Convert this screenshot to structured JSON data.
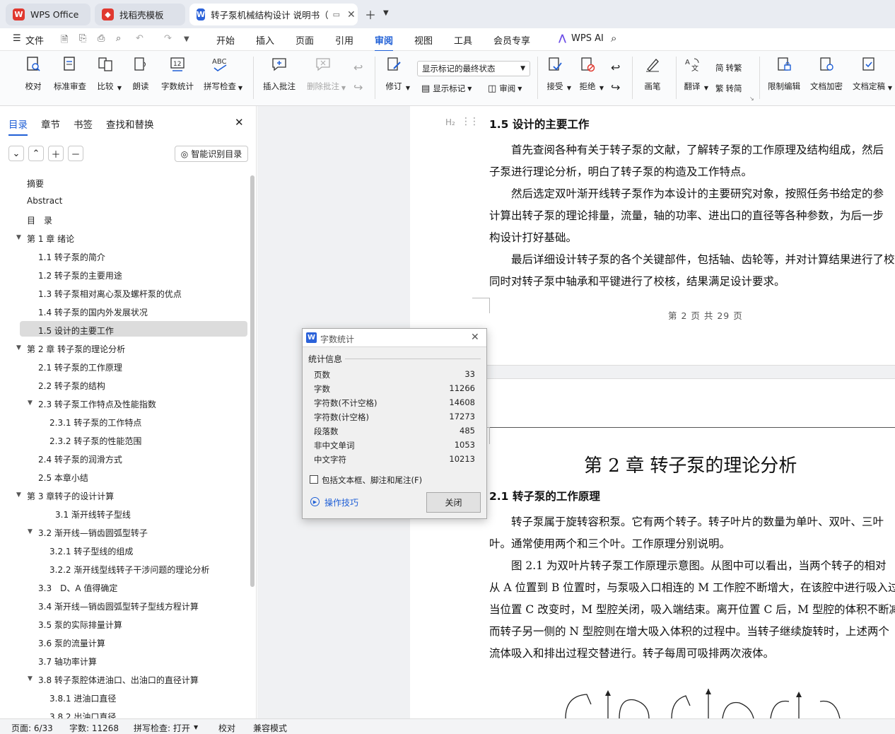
{
  "tabs": [
    {
      "label": "WPS Office"
    },
    {
      "label": "找稻壳模板"
    },
    {
      "label": "转子泵机械结构设计 说明书（"
    }
  ],
  "menu": {
    "file": "文件",
    "items": [
      "开始",
      "插入",
      "页面",
      "引用",
      "审阅",
      "视图",
      "工具",
      "会员专享"
    ],
    "active": "审阅",
    "ai": "WPS AI"
  },
  "ribbon": {
    "jiaodui": "校对",
    "biaozhun": "标准审查",
    "bijiao": "比较",
    "langdu": "朗读",
    "zishu": "字数统计",
    "pinxie": "拼写检查",
    "charu": "插入批注",
    "shanchu": "删除批注",
    "xiuding": "修订",
    "dropdown": "显示标记的最终状态",
    "xianshi": "显示标记",
    "shenyue": "审阅",
    "jieshou": "接受",
    "jujue": "拒绝",
    "huabi": "画笔",
    "fanyi": "翻译",
    "zhuanfan": "转繁",
    "zhuanjian": "转简",
    "xianzhi": "限制编辑",
    "jiami": "文档加密",
    "dinggao": "文档定稿"
  },
  "panel": {
    "tabs": [
      "目录",
      "章节",
      "书签",
      "查找和替换"
    ],
    "smart": "智能识别目录",
    "toc": [
      {
        "text": "摘要",
        "level": 0
      },
      {
        "text": "Abstract",
        "level": 0
      },
      {
        "text": "目　录",
        "level": 0
      },
      {
        "text": "第 1 章  绪论",
        "level": 0,
        "exp": true
      },
      {
        "text": "1.1  转子泵的简介",
        "level": 1
      },
      {
        "text": "1.2  转子泵的主要用途",
        "level": 1
      },
      {
        "text": "1.3  转子泵相对离心泵及螺杆泵的优点",
        "level": 1
      },
      {
        "text": "1.4  转子泵的国内外发展状况",
        "level": 1
      },
      {
        "text": "1.5  设计的主要工作",
        "level": 1,
        "sel": true
      },
      {
        "text": "第 2 章  转子泵的理论分析",
        "level": 0,
        "exp": true
      },
      {
        "text": "2.1  转子泵的工作原理",
        "level": 1
      },
      {
        "text": "2.2  转子泵的结构",
        "level": 1
      },
      {
        "text": "2.3  转子泵工作特点及性能指数",
        "level": 1,
        "exp": true
      },
      {
        "text": "2.3.1  转子泵的工作特点",
        "level": 2
      },
      {
        "text": "2.3.2  转子泵的性能范围",
        "level": 2
      },
      {
        "text": "2.4  转子泵的润滑方式",
        "level": 1
      },
      {
        "text": "2.5  本章小结",
        "level": 1
      },
      {
        "text": "第 3 章转子的设计计算",
        "level": 0,
        "exp": true
      },
      {
        "text": "3.1  渐开线转子型线",
        "level": 3
      },
      {
        "text": "3.2  渐开线—销齿圆弧型转子",
        "level": 1,
        "exp": true
      },
      {
        "text": "3.2.1  转子型线的组成",
        "level": 2
      },
      {
        "text": "3.2.2  渐开线型线转子干涉问题的理论分析",
        "level": 2
      },
      {
        "text": "3.3　D、A 值得确定",
        "level": 1
      },
      {
        "text": "3.4  渐开线—销齿圆弧型转子型线方程计算",
        "level": 1
      },
      {
        "text": "3.5  泵的实际排量计算",
        "level": 1
      },
      {
        "text": "3.6  泵的流量计算",
        "level": 1
      },
      {
        "text": "3.7  轴功率计算",
        "level": 1
      },
      {
        "text": "3.8  转子泵腔体进油口、出油口的直径计算",
        "level": 1,
        "exp": true
      },
      {
        "text": "3.8.1  进油口直径",
        "level": 2
      },
      {
        "text": "3.8.2  出油口直径",
        "level": 2
      }
    ]
  },
  "doc": {
    "h15": "1.5  设计的主要工作",
    "h2mark": "H₂",
    "p": [
      "首先查阅各种有关于转子泵的文献，了解转子泵的工作原理及结构组成，然后",
      "子泵进行理论分析，明白了转子泵的构造及工作特点。",
      "然后选定双叶渐开线转子泵作为本设计的主要研究对象，按照任务书给定的参",
      "计算出转子泵的理论排量，流量，轴的功率、进出口的直径等各种参数，为后一步",
      "构设计打好基础。",
      "最后详细设计转子泵的各个关键部件，包括轴、齿轮等，并对计算结果进行了校",
      "同时对转子泵中轴承和平键进行了校核，结果满足设计要求。"
    ],
    "footer": "第 2 页 共 29 页",
    "chapter": "第 2 章  转子泵的理论分析",
    "h21": "2.1  转子泵的工作原理",
    "q": [
      "转子泵属于旋转容积泵。它有两个转子。转子叶片的数量为单叶、双叶、三叶",
      "叶。通常使用两个和三个叶。工作原理分别说明。",
      "图 2.1 为双叶片转子泵工作原理示意图。从图中可以看出，当两个转子的相对",
      "从 A 位置到 B 位置时，与泵吸入口相连的 M 工作腔不断增大，在该腔中进行吸入过",
      "当位置 C 改变时，M 型腔关闭，吸入端结束。离开位置 C 后，M 型腔的体积不断减",
      "而转子另一侧的 N 型腔则在增大吸入体积的过程中。当转子继续旋转时，上述两个",
      "流体吸入和排出过程交替进行。转子每周可吸排两次液体。"
    ]
  },
  "dialog": {
    "title": "字数统计",
    "section": "统计信息",
    "rows": [
      {
        "k": "页数",
        "v": "33"
      },
      {
        "k": "字数",
        "v": "11266"
      },
      {
        "k": "字符数(不计空格)",
        "v": "14608"
      },
      {
        "k": "字符数(计空格)",
        "v": "17273"
      },
      {
        "k": "段落数",
        "v": "485"
      },
      {
        "k": "非中文单词",
        "v": "1053"
      },
      {
        "k": "中文字符",
        "v": "10213"
      }
    ],
    "checkbox": "包括文本框、脚注和尾注(F)",
    "tips": "操作技巧",
    "close": "关闭"
  },
  "status": {
    "page": "页面: 6/33",
    "words": "字数: 11268",
    "spell": "拼写检查: 打开",
    "proof": "校对",
    "compat": "兼容模式"
  },
  "colors": {
    "accent": "#1f5fd6",
    "wps_red": "#e0382f",
    "word_blue": "#2b62d9"
  }
}
